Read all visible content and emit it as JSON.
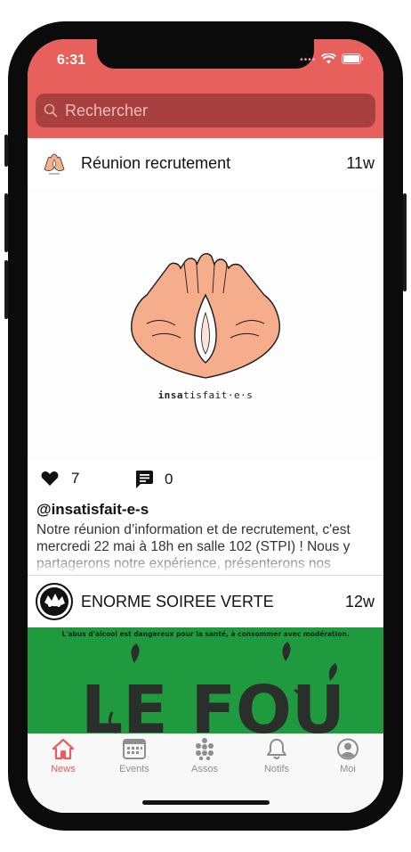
{
  "status": {
    "time": "6:31"
  },
  "search": {
    "placeholder": "Rechercher"
  },
  "posts": [
    {
      "title": "Réunion recrutement",
      "time": "11w",
      "image_brand_bold": "insa",
      "image_brand_rest": "tisfait·e·s",
      "likes": "7",
      "comments": "0",
      "author": "@insatisfait-e-s",
      "body": "Notre réunion d’information et de recrutement, c'est mercredi 22 mai à 18h en salle 102 (STPI) !  Nous y partagerons notre expérience, présenterons nos"
    },
    {
      "title": "ENORME SOIREE VERTE",
      "time": "12w",
      "poster_text": "L'abus d'alcool est dangereux pour la santé, à consommer avec modération.",
      "poster_big": "LE FOU"
    }
  ],
  "tabs": [
    {
      "label": "News",
      "icon": "home-icon",
      "active": true
    },
    {
      "label": "Events",
      "icon": "calendar-icon"
    },
    {
      "label": "Assos",
      "icon": "dots-icon"
    },
    {
      "label": "Notifs",
      "icon": "bell-icon"
    },
    {
      "label": "Moi",
      "icon": "user-icon"
    }
  ],
  "colors": {
    "accent": "#e8605c",
    "search_bg": "#a94040",
    "poster_green": "#1f9a3e"
  }
}
